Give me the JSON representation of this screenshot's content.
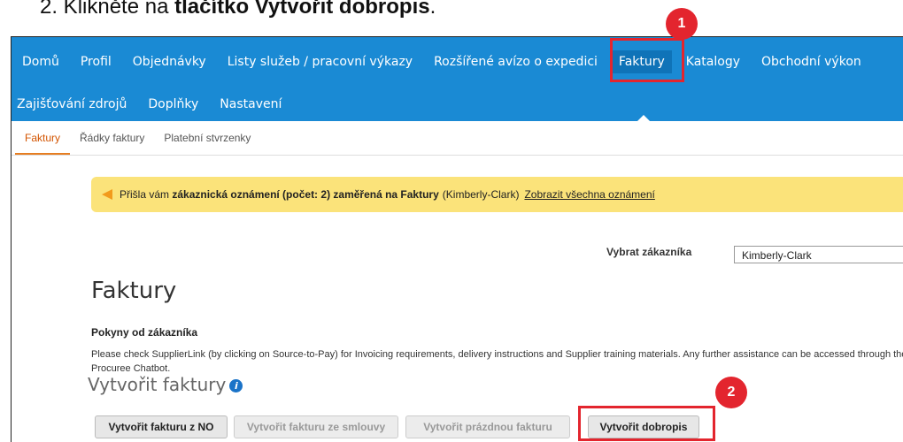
{
  "heading": {
    "prefix": "2.   Klikněte na ",
    "bold": "tlačítko Vytvořit dobropis",
    "suffix": "."
  },
  "nav": {
    "row1": [
      "Domů",
      "Profil",
      "Objednávky",
      "Listy služeb / pracovní výkazy",
      "Rozšířené avízo o expedici",
      "Faktury",
      "Katalogy",
      "Obchodní výkon"
    ],
    "row2": [
      "Zajišťování zdrojů",
      "Doplňky",
      "Nastavení"
    ]
  },
  "subtabs": [
    "Faktury",
    "Řádky faktury",
    "Platební stvrzenky"
  ],
  "alert": {
    "text_a": "Přišla vám ",
    "text_bold": "zákaznická oznámení (počet: 2) zaměřená na Faktury",
    "customer": "(Kimberly-Clark)",
    "link": "Zobrazit všechna oznámení"
  },
  "customer_select": {
    "label": "Vybrat zákazníka",
    "value": "Kimberly-Clark"
  },
  "page_title": "Faktury",
  "instructions": {
    "title": "Pokyny od zákazníka",
    "text": "Please check SupplierLink (by clicking on Source-to-Pay) for Invoicing requirements, delivery instructions and Supplier training materials. Any further assistance can be accessed through the Procuree Chatbot."
  },
  "create_title": "Vytvořit faktury",
  "buttons": {
    "from_po": "Vytvořit fakturu z NO",
    "from_contract": "Vytvořit fakturu ze smlouvy",
    "blank": "Vytvořit prázdnou fakturu",
    "credit_memo": "Vytvořit dobropis"
  },
  "badges": {
    "one": "1",
    "two": "2"
  },
  "colors": {
    "nav": "#1a8ad4",
    "highlight": "#e3252e",
    "alert": "#fbe37a"
  }
}
